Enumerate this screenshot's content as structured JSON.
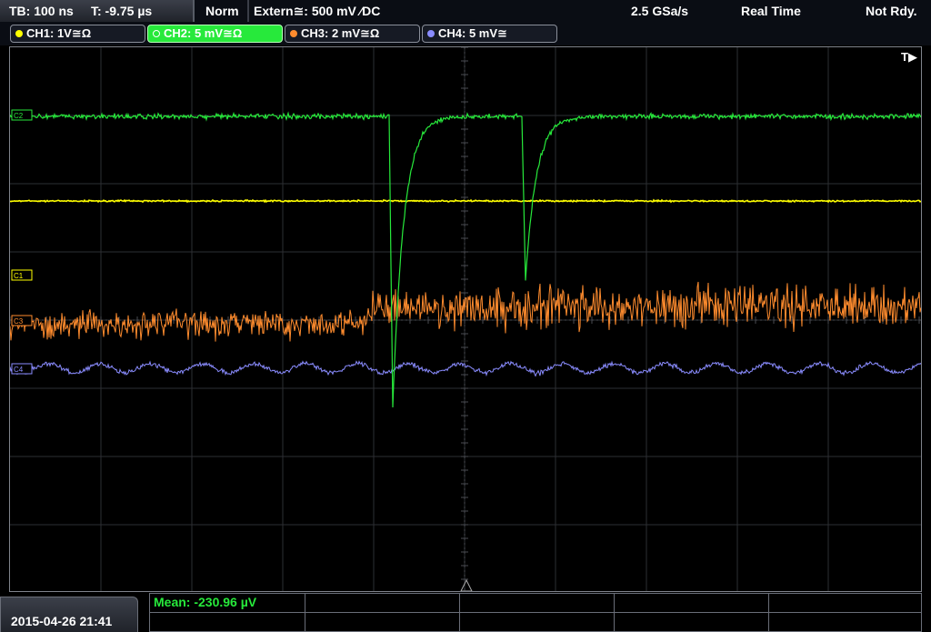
{
  "status_bar": {
    "timebase": "TB: 100 ns",
    "trigger_time": "T: -9.75 µs",
    "trigger_mode": "Norm",
    "trigger_source": "Extern≅: 500 mV ⁄DC",
    "sample_rate": "2.5 GSa/s",
    "acquisition": "Real Time",
    "ready_state": "Not Rdy."
  },
  "channels": [
    {
      "label": "CH1: 1V≅Ω",
      "color": "#ffff00",
      "active": false
    },
    {
      "label": "CH2: 5 mV≅Ω",
      "color": "#27e93b",
      "active": true
    },
    {
      "label": "CH3: 2 mV≅Ω",
      "color": "#ff8c2e",
      "active": false
    },
    {
      "label": "CH4: 5 mV≅",
      "color": "#8a8cff",
      "active": false
    }
  ],
  "screen": {
    "trigger_indicator": "T▶",
    "markers": {
      "ch2": "C2",
      "ch1": "C1",
      "ch3": "C3",
      "ch4": "C4"
    }
  },
  "bottom": {
    "datetime": "2015-04-26 21:41",
    "measurement": "Mean: -230.96 µV"
  }
}
